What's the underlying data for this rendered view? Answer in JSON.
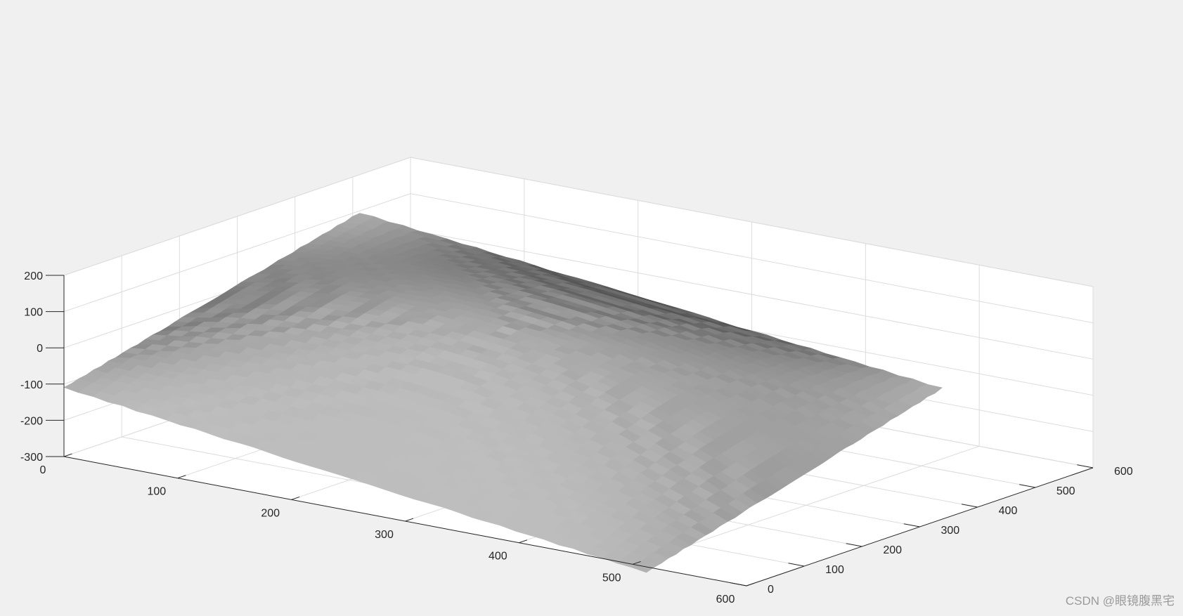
{
  "figure": {
    "background": "#f0f0f0",
    "axes_background": "#ffffff",
    "grid_color": "#dcdcdc",
    "axis_color": "#262626",
    "surface_colormap": "gray",
    "watermark": "CSDN @眼镜腹黑宅"
  },
  "chart_data": {
    "type": "surface3d",
    "title": "",
    "xlabel": "",
    "ylabel": "",
    "zlabel": "",
    "xlim": [
      0,
      600
    ],
    "ylim": [
      0,
      600
    ],
    "zlim": [
      -300,
      200
    ],
    "xticks": [
      0,
      100,
      200,
      300,
      400,
      500,
      600
    ],
    "yticks": [
      0,
      100,
      200,
      300,
      400,
      500,
      600
    ],
    "zticks": [
      -300,
      -200,
      -100,
      0,
      100,
      200
    ],
    "grid": true,
    "surface": {
      "x_range": [
        0,
        512
      ],
      "y_range": [
        0,
        512
      ],
      "shape": "dome",
      "z_center": 36,
      "z_corners": {
        "x0_y0": -110,
        "x512_y0": -315,
        "x0_y512": 95,
        "x512_y512": -85
      },
      "peak": {
        "x": 40,
        "y": 400,
        "z": 200
      }
    }
  }
}
